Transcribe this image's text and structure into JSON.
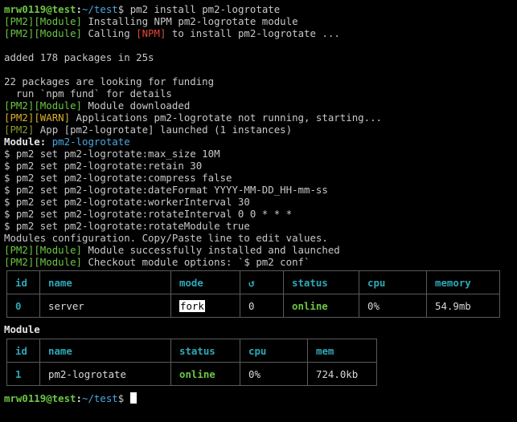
{
  "session": {
    "user_host": "mrw0119@test",
    "path": "~/test",
    "prompt_symbol": "$",
    "command": "pm2 install pm2-logrotate"
  },
  "log": {
    "pm2_tag": "[PM2]",
    "module_tag": "[Module]",
    "warn_tag": "[WARN]",
    "npm_tag": "[NPM]",
    "installing": " Installing NPM pm2-logrotate module",
    "calling_pre": " Calling ",
    "calling_post": " to install pm2-logrotate ...",
    "added": "added 178 packages in 25s",
    "funding1": "22 packages are looking for funding",
    "funding2": "  run `npm fund` for details",
    "downloaded": " Module downloaded",
    "warn_msg": " Applications pm2-logrotate not running, starting...",
    "launched": " App [pm2-logrotate] launched (1 instances)",
    "module_label": "Module: ",
    "module_name": "pm2-logrotate",
    "config_lines": [
      "$ pm2 set pm2-logrotate:max_size 10M",
      "$ pm2 set pm2-logrotate:retain 30",
      "$ pm2 set pm2-logrotate:compress false",
      "$ pm2 set pm2-logrotate:dateFormat YYYY-MM-DD_HH-mm-ss",
      "$ pm2 set pm2-logrotate:workerInterval 30",
      "$ pm2 set pm2-logrotate:rotateInterval 0 0 * * *",
      "$ pm2 set pm2-logrotate:rotateModule true"
    ],
    "config_note": "Modules configuration. Copy/Paste line to edit values.",
    "success": " Module successfully installed and launched",
    "checkout": " Checkout module options: `$ pm2 conf`"
  },
  "apps_table": {
    "headers": [
      "id",
      "name",
      "mode",
      "↺",
      "status",
      "cpu",
      "memory"
    ],
    "row": {
      "id": "0",
      "name": "server",
      "mode": "fork",
      "restarts": "0",
      "status": "online",
      "cpu": "0%",
      "memory": "54.9mb"
    }
  },
  "module_section_title": "Module",
  "modules_table": {
    "headers": [
      "id",
      "name",
      "status",
      "cpu",
      "mem"
    ],
    "row": {
      "id": "1",
      "name": "pm2-logrotate",
      "status": "online",
      "cpu": "0%",
      "mem": "724.0kb"
    }
  },
  "colors": {
    "background": "#000000",
    "pm2_tag": "#6cc644",
    "warn_tag": "#d8b02a",
    "npm_tag": "#e0483a",
    "path": "#4aa8e0",
    "table_header": "#2fa8b8",
    "online": "#6cc644"
  }
}
